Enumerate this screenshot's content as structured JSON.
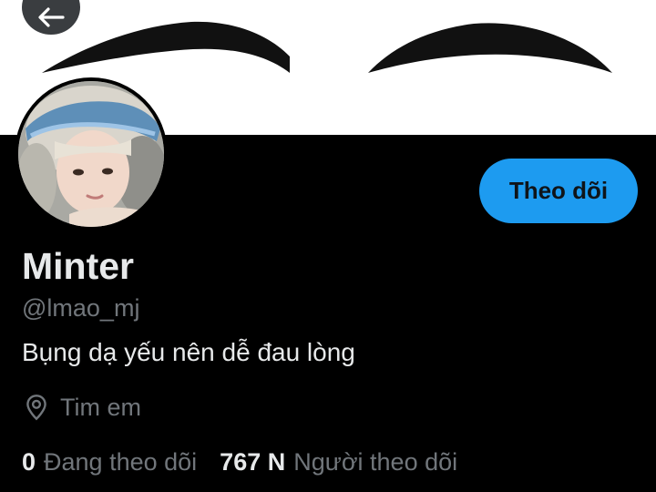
{
  "profile": {
    "display_name": "Minter",
    "handle": "@lmao_mj",
    "bio": "Bụng dạ yếu nên dễ đau lòng",
    "location": "Tim em",
    "follow_label": "Theo dõi",
    "following_count": "0",
    "following_label": "Đang theo dõi",
    "followers_count": "767 N",
    "followers_label": "Người theo dõi"
  },
  "icons": {
    "back": "arrow-left-icon",
    "location": "location-pin-icon"
  },
  "colors": {
    "accent": "#1d9bf0",
    "background": "#000000",
    "text_primary": "#e7e9ea",
    "text_secondary": "#71767b"
  }
}
